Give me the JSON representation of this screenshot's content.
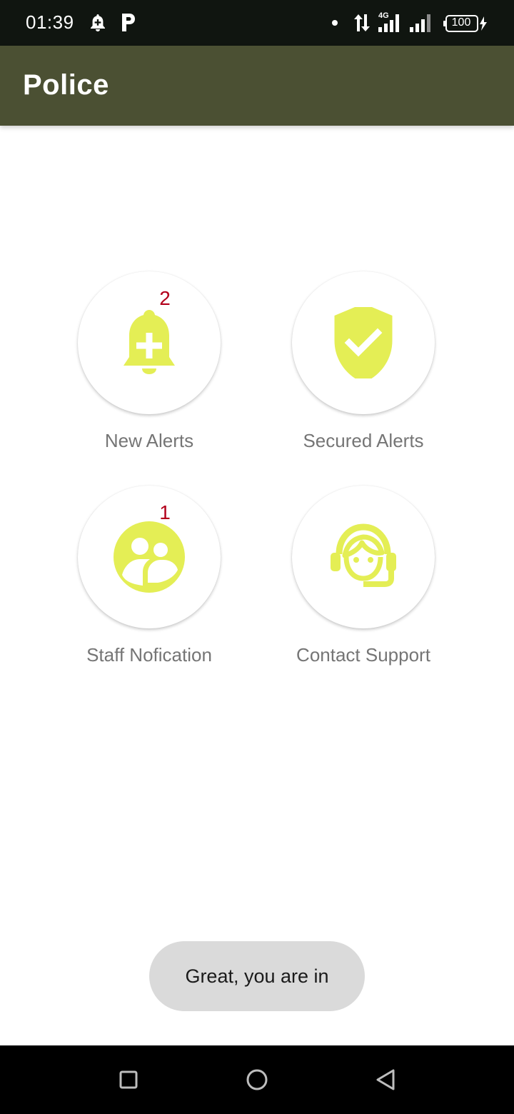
{
  "status_bar": {
    "time": "01:39",
    "battery": "100",
    "icons": [
      "alarm-icon",
      "parking-icon",
      "dot-icon",
      "data-transfer-icon",
      "signal-4g-icon",
      "signal-icon",
      "battery-icon",
      "charging-icon"
    ]
  },
  "app_bar": {
    "title": "Police",
    "background": "#4b5033"
  },
  "tiles": [
    {
      "label": "New Alerts",
      "badge": "2",
      "icon": "bell-plus-icon"
    },
    {
      "label": "Secured Alerts",
      "badge": "",
      "icon": "shield-check-icon"
    },
    {
      "label": "Staff Nofication",
      "badge": "1",
      "icon": "group-chat-icon"
    },
    {
      "label": "Contact Support",
      "badge": "",
      "icon": "support-agent-icon"
    }
  ],
  "accent_color": "#e4ee55",
  "badge_color": "#b3001b",
  "toast": {
    "message": "Great, you are in"
  },
  "nav_bar": {
    "buttons": [
      "recents-button",
      "home-button",
      "back-button"
    ]
  }
}
